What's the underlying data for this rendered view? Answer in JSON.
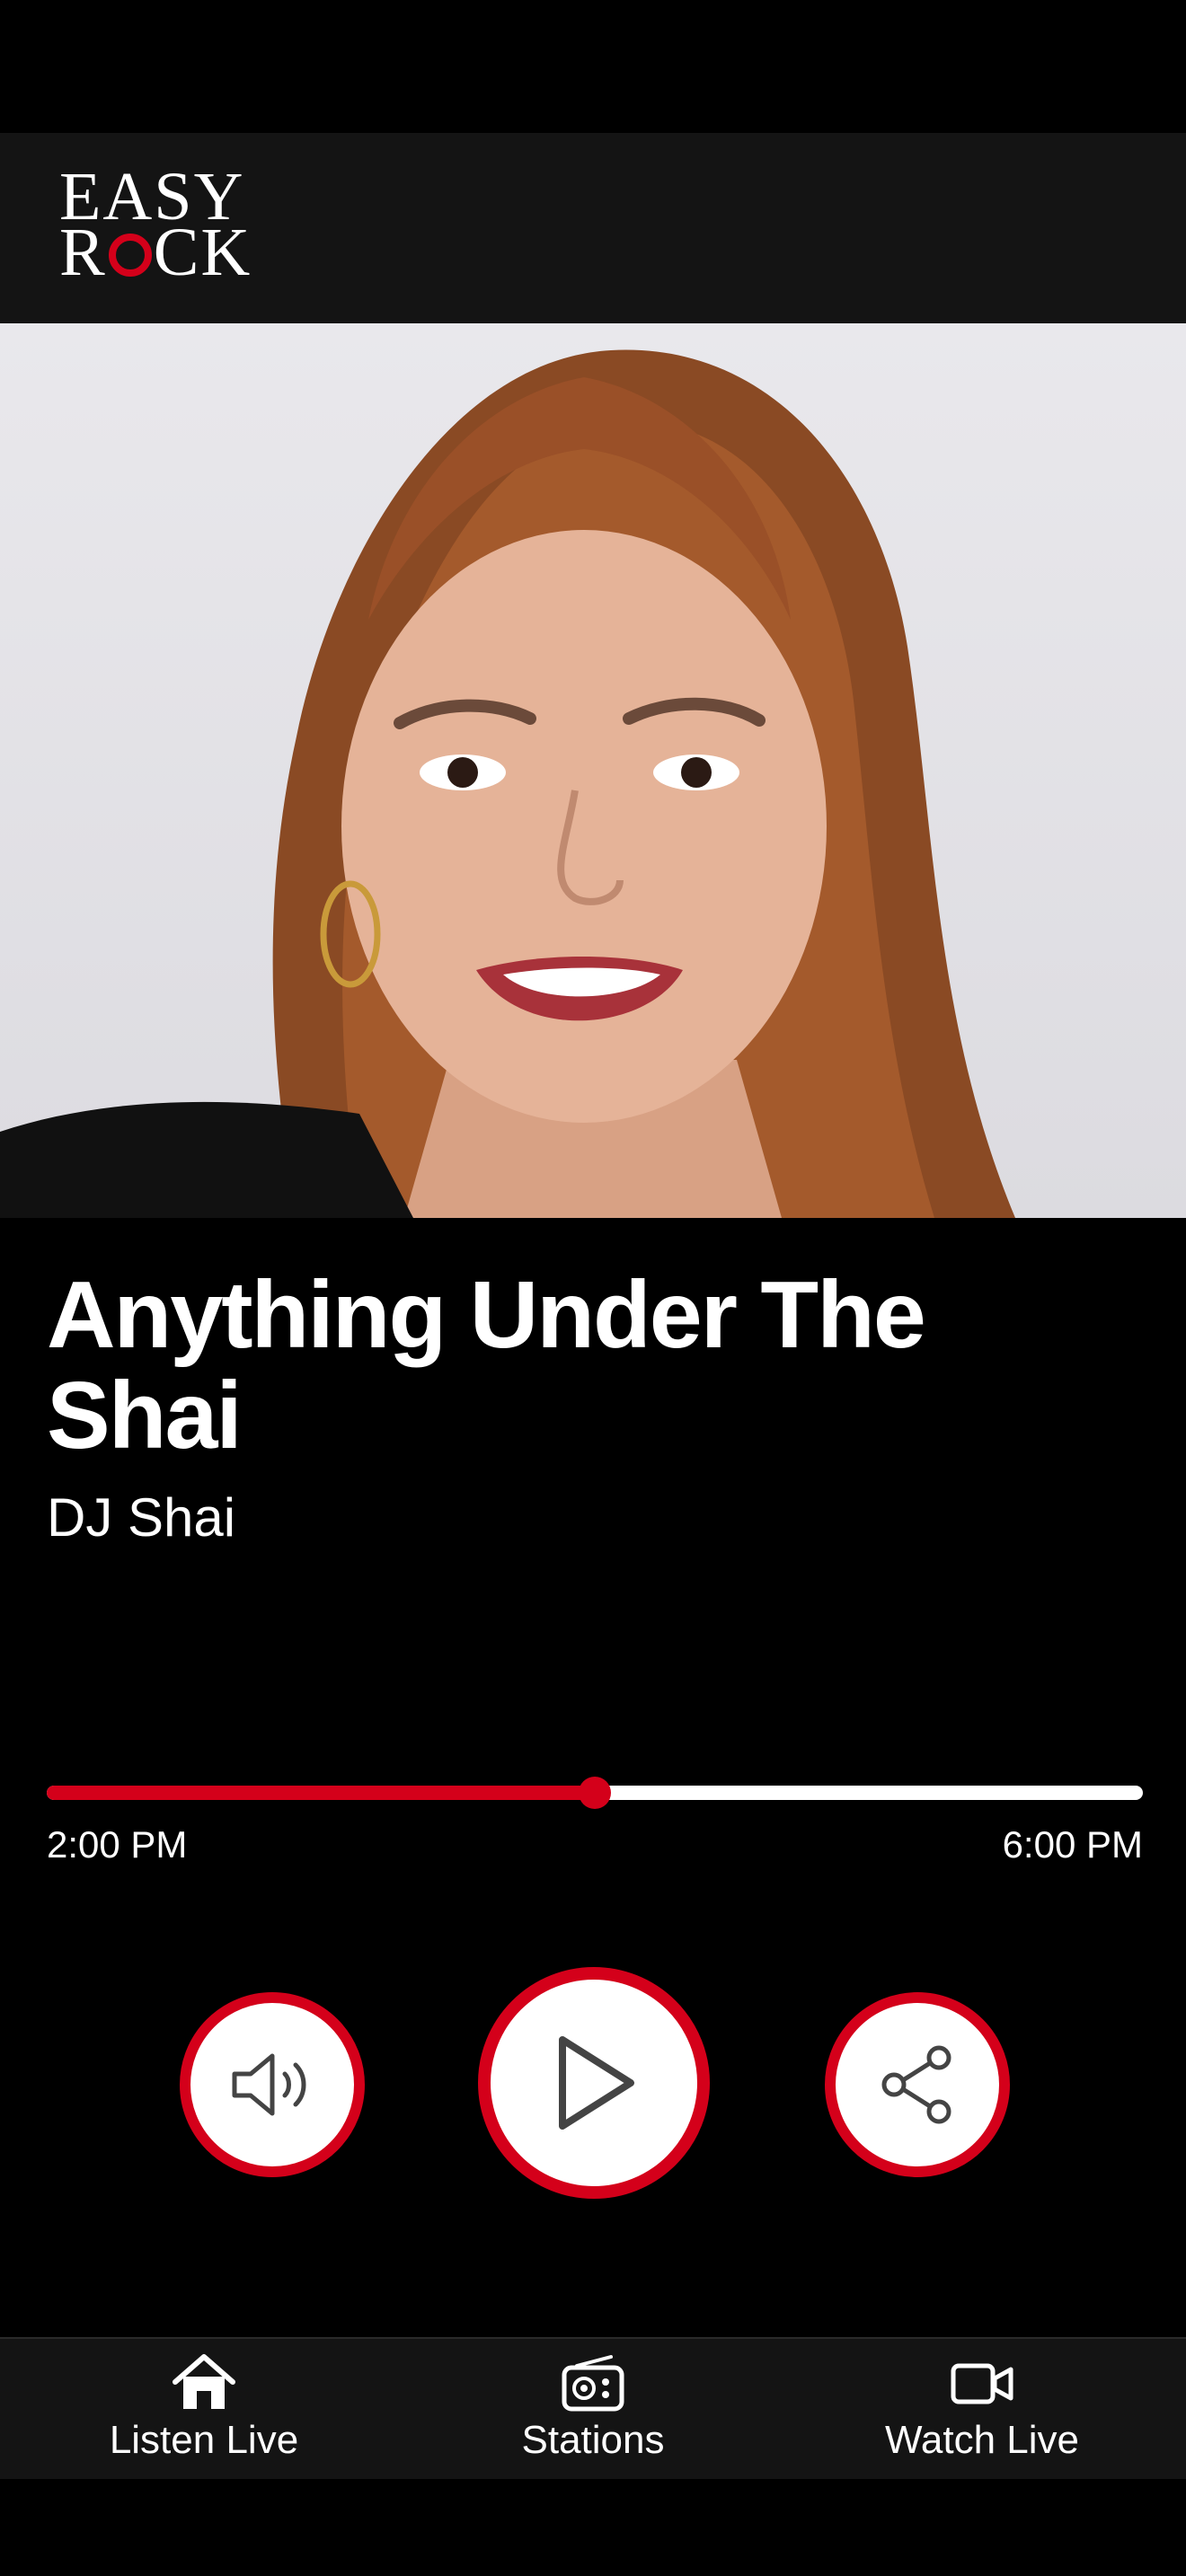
{
  "app": {
    "logo_line1": "EASY",
    "logo_line2_prefix": "R",
    "logo_line2_suffix": "CK"
  },
  "now_playing": {
    "show_title": "Anything Under The Shai",
    "host": "DJ Shai",
    "progress_fraction": 0.5,
    "start_time": "2:00 PM",
    "end_time": "6:00 PM"
  },
  "controls": {
    "volume_icon": "speaker-icon",
    "play_icon": "play-icon",
    "share_icon": "share-icon"
  },
  "nav": {
    "items": [
      {
        "label": "Listen Live",
        "icon": "home-icon"
      },
      {
        "label": "Stations",
        "icon": "radio-icon"
      },
      {
        "label": "Watch Live",
        "icon": "video-camera-icon"
      }
    ]
  },
  "colors": {
    "accent": "#d4001a",
    "background": "#000000",
    "bar": "#141414"
  }
}
